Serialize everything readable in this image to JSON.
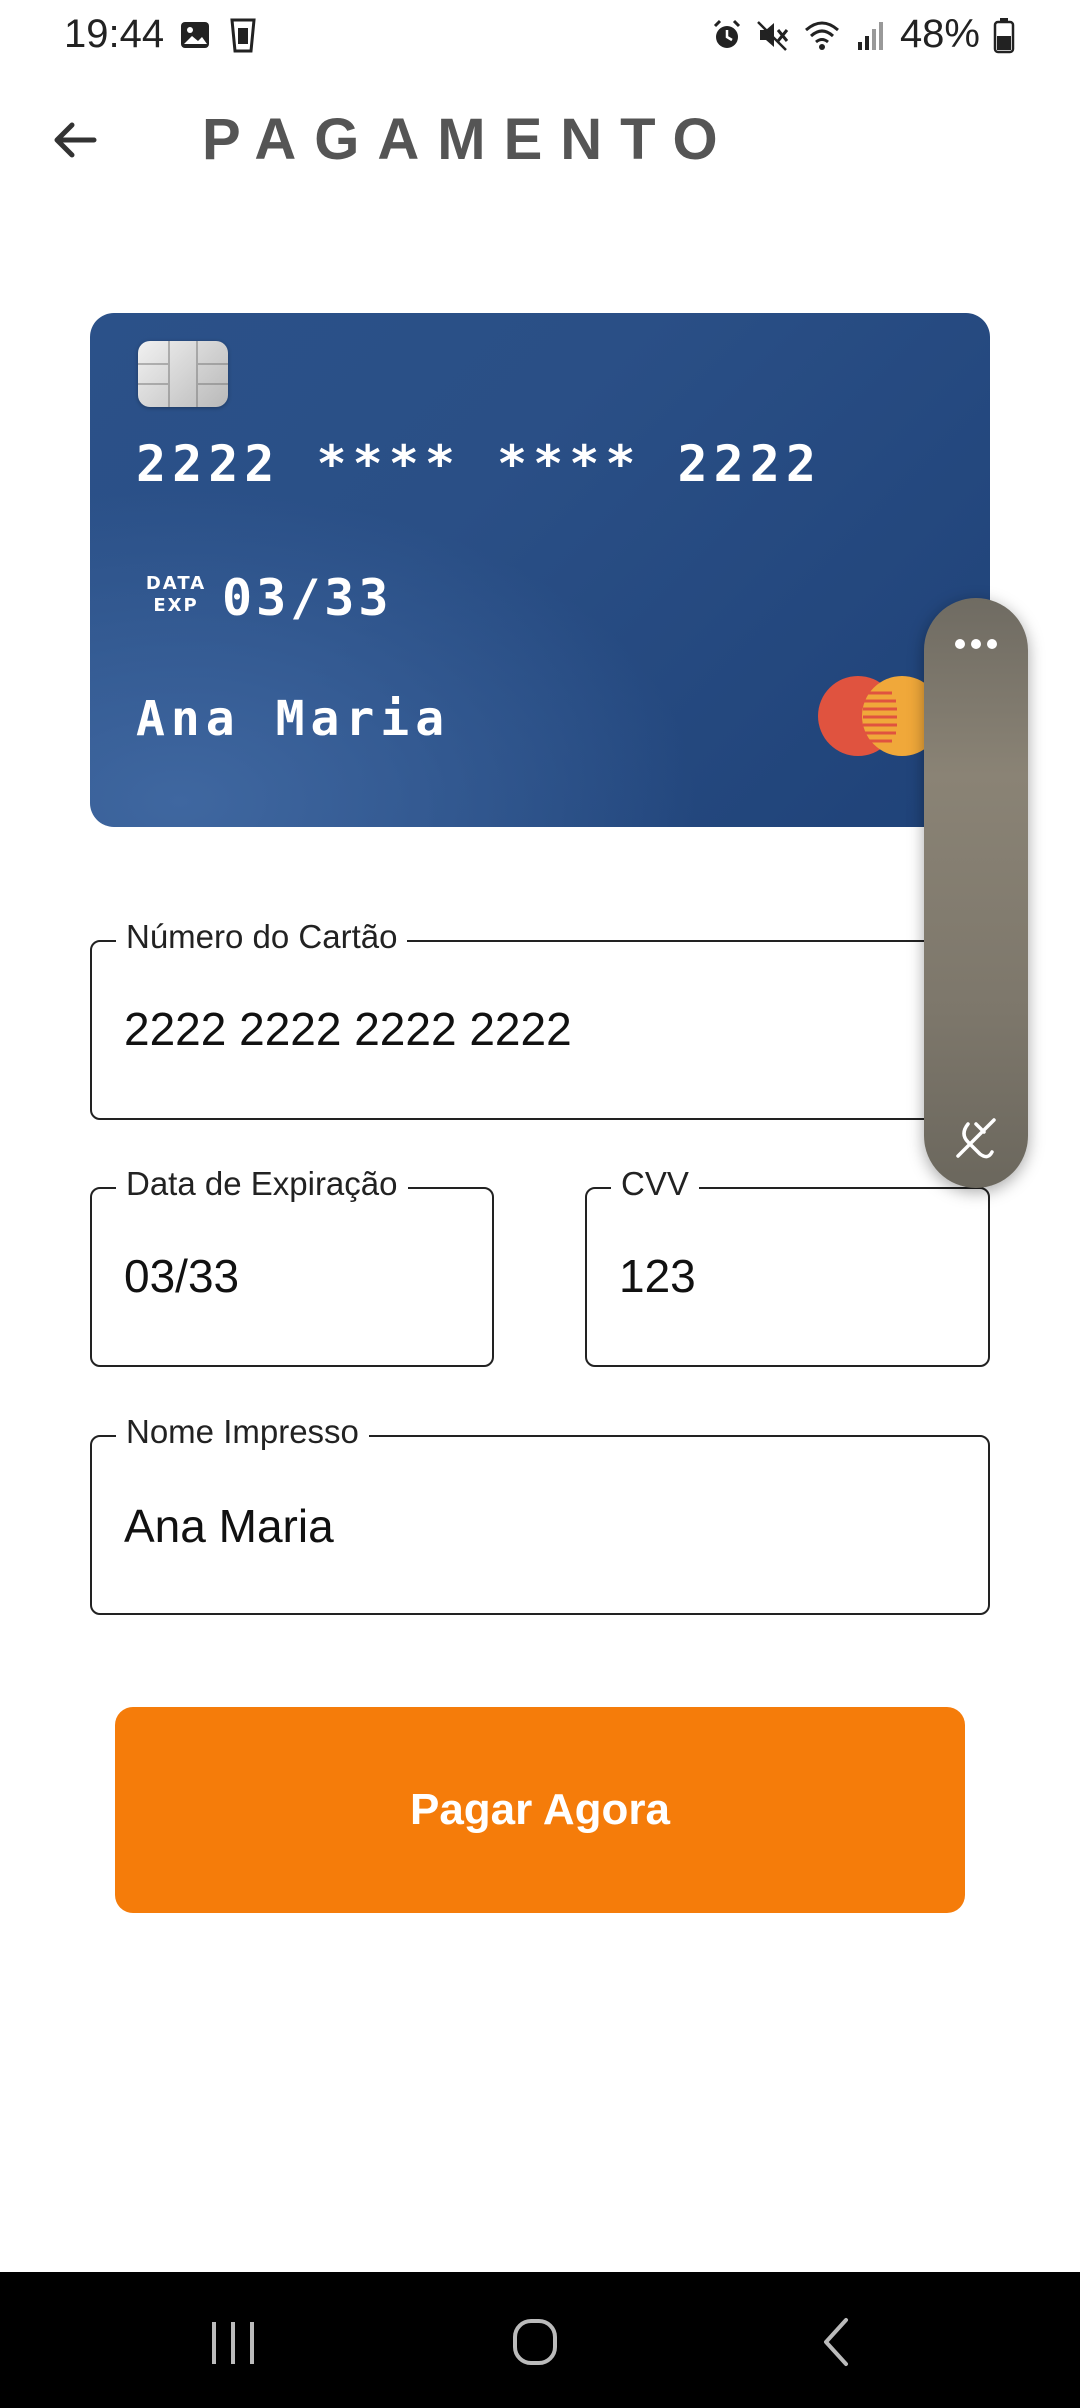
{
  "status_bar": {
    "time": "19:44",
    "battery_percent": "48%",
    "icons_left": [
      "image-icon",
      "cup-icon"
    ],
    "icons_right": [
      "alarm-icon",
      "mute-icon",
      "wifi-icon",
      "signal-icon",
      "battery-icon"
    ]
  },
  "header": {
    "title": "PAGAMENTO",
    "back_icon": "arrow-left-icon"
  },
  "card": {
    "number": "2222 **** **** 2222",
    "exp_label_top": "DATA",
    "exp_label_bottom": "EXP",
    "exp_value": "03/33",
    "holder": "Ana Maria",
    "brand_icon": "mastercard-logo-icon",
    "colors": {
      "background": "#2a4f86",
      "brand_red": "#e0533f",
      "brand_yellow": "#f0a83a"
    }
  },
  "form": {
    "card_number": {
      "label": "Número do Cartão",
      "value": "2222 2222 2222 2222"
    },
    "expiration": {
      "label": "Data de Expiração",
      "value": "03/33"
    },
    "cvv": {
      "label": "CVV",
      "value": "123"
    },
    "name": {
      "label": "Nome Impresso",
      "value": "Ana Maria"
    }
  },
  "actions": {
    "pay_label": "Pagar Agora",
    "accent_color": "#f57c0a"
  },
  "overlay": {
    "icons": [
      "more-dots-icon",
      "hide-icon"
    ]
  },
  "nav_bar": {
    "icons": [
      "recents-icon",
      "home-icon",
      "back-icon"
    ]
  }
}
